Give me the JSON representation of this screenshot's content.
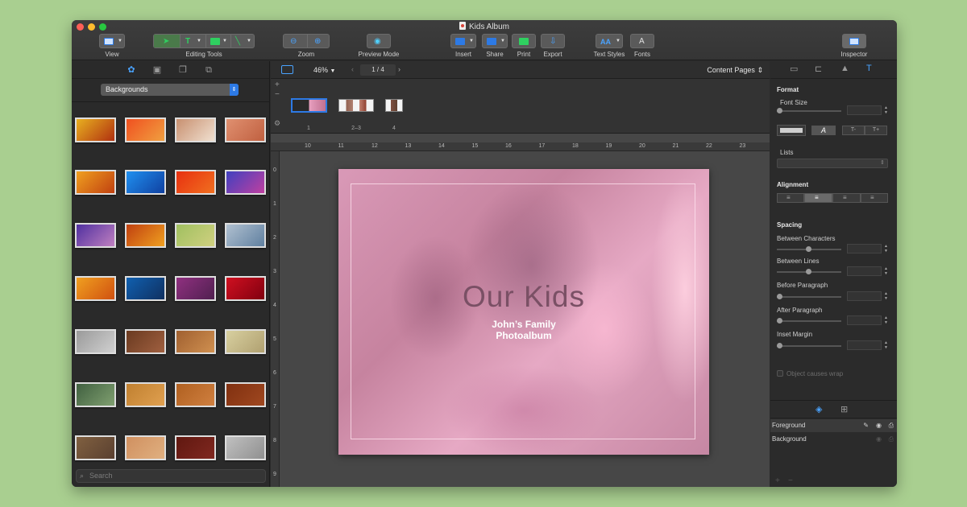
{
  "window": {
    "title": "Kids Album"
  },
  "toolbar": {
    "view": "View",
    "editing_tools": "Editing Tools",
    "zoom": "Zoom",
    "preview_mode": "Preview Mode",
    "insert": "Insert",
    "share": "Share",
    "print": "Print",
    "export": "Export",
    "text_styles": "Text Styles",
    "fonts": "Fonts",
    "inspector": "Inspector",
    "text_tool_glyph": "T",
    "fonts_glyph": "A",
    "text_styles_glyph": "AA"
  },
  "library": {
    "category": "Backgrounds",
    "search_placeholder": "Search",
    "thumbnails": [
      {
        "c1": "#e8b020",
        "c2": "#b03010"
      },
      {
        "c1": "#f05020",
        "c2": "#f0a040"
      },
      {
        "c1": "#c89070",
        "c2": "#f0e0d0"
      },
      {
        "c1": "#e09070",
        "c2": "#c06040"
      },
      {
        "c1": "#f0a020",
        "c2": "#c04010"
      },
      {
        "c1": "#2090f0",
        "c2": "#1040a0"
      },
      {
        "c1": "#e83010",
        "c2": "#f07020"
      },
      {
        "c1": "#4040c0",
        "c2": "#c040a0"
      },
      {
        "c1": "#5030a0",
        "c2": "#c080c0"
      },
      {
        "c1": "#c04010",
        "c2": "#f0a020"
      },
      {
        "c1": "#a0c060",
        "c2": "#d0d080"
      },
      {
        "c1": "#b0c0d0",
        "c2": "#6080a0"
      },
      {
        "c1": "#f0a020",
        "c2": "#d05010"
      },
      {
        "c1": "#1060b0",
        "c2": "#103060"
      },
      {
        "c1": "#903080",
        "c2": "#502050"
      },
      {
        "c1": "#d01020",
        "c2": "#800010"
      },
      {
        "c1": "#9a9a9a",
        "c2": "#d0d0d0"
      },
      {
        "c1": "#6a3a20",
        "c2": "#a06040"
      },
      {
        "c1": "#a06030",
        "c2": "#d09050"
      },
      {
        "c1": "#d8d0a0",
        "c2": "#b0a070"
      },
      {
        "c1": "#406040",
        "c2": "#80a070"
      },
      {
        "c1": "#c08030",
        "c2": "#e0a050"
      },
      {
        "c1": "#b06020",
        "c2": "#d08040"
      },
      {
        "c1": "#803010",
        "c2": "#a04820"
      },
      {
        "c1": "#806040",
        "c2": "#5a4030"
      },
      {
        "c1": "#d09060",
        "c2": "#e0b080"
      },
      {
        "c1": "#601810",
        "c2": "#802820"
      },
      {
        "c1": "#c0c0c0",
        "c2": "#909090"
      }
    ]
  },
  "canvas": {
    "zoom": "46%",
    "page_indicator": "1 / 4",
    "content_pages": "Content Pages",
    "pages": [
      {
        "label": "1"
      },
      {
        "label": "2–3"
      },
      {
        "label": "4"
      }
    ],
    "ruler_top": [
      "10",
      "11",
      "12",
      "13",
      "14",
      "15",
      "16",
      "17",
      "18",
      "19",
      "20",
      "21",
      "22",
      "23"
    ],
    "ruler_left": [
      "0",
      "1",
      "2",
      "3",
      "4",
      "5",
      "6",
      "7",
      "8",
      "9"
    ],
    "title": "Our Kids",
    "subtitle_line1": "John’s Family",
    "subtitle_line2": "Photoalbum"
  },
  "inspector": {
    "format": "Format",
    "font_size": "Font Size",
    "lists": "Lists",
    "alignment": "Alignment",
    "spacing": "Spacing",
    "between_characters": "Between Characters",
    "between_lines": "Between Lines",
    "before_paragraph": "Before Paragraph",
    "after_paragraph": "After Paragraph",
    "inset_margin": "Inset Margin",
    "object_causes_wrap": "Object causes wrap",
    "italic_glyph": "A",
    "subscript_glyph": "T-",
    "superscript_glyph": "T+"
  },
  "layers": {
    "foreground": "Foreground",
    "background": "Background"
  }
}
